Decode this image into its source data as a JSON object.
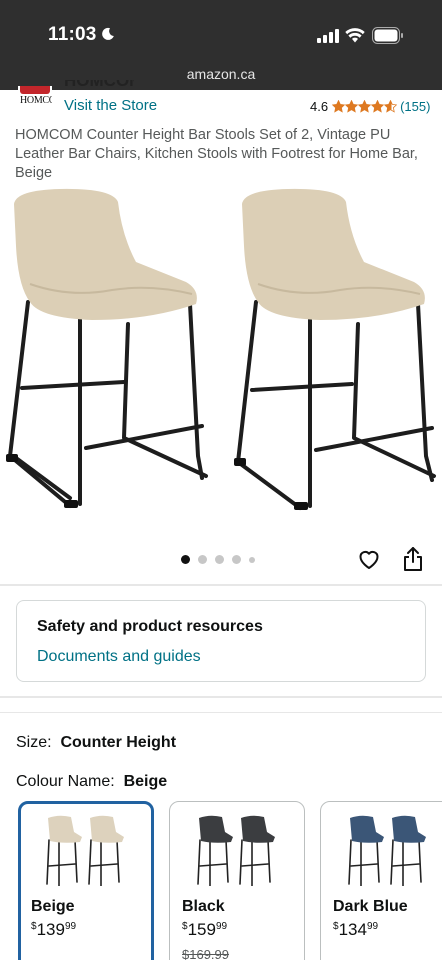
{
  "status_bar": {
    "time": "11:03"
  },
  "browser": {
    "url": "amazon.ca"
  },
  "brand": {
    "logo_text": "HOMCOM",
    "name": "HOMCOM",
    "visit_store": "Visit the Store"
  },
  "rating": {
    "value": "4.6",
    "stars": 4.6,
    "count": "(155)"
  },
  "product": {
    "title": "HOMCOM Counter Height Bar Stools Set of 2, Vintage PU Leather Bar Chairs, Kitchen Stools with Footrest for Home Bar, Beige",
    "image_count": 5,
    "current_image": 1
  },
  "safety": {
    "title": "Safety and product resources",
    "link": "Documents and guides"
  },
  "size": {
    "label": "Size:",
    "value": "Counter Height"
  },
  "colour": {
    "label": "Colour Name:",
    "value": "Beige",
    "options": [
      {
        "name": "Beige",
        "currency": "$",
        "whole": "139",
        "cents": "99",
        "list_price": "",
        "seat_color": "#ddd2bd",
        "selected": true
      },
      {
        "name": "Black",
        "currency": "$",
        "whole": "159",
        "cents": "99",
        "list_price": "$169.99",
        "seat_color": "#3b3d40",
        "selected": false
      },
      {
        "name": "Dark Blue",
        "currency": "$",
        "whole": "134",
        "cents": "99",
        "list_price": "",
        "seat_color": "#3b5677",
        "selected": false
      }
    ]
  },
  "colors": {
    "link": "#007185",
    "star": "#de7921",
    "selected_border": "#2162a1",
    "topbar": "#2f2f2f"
  }
}
